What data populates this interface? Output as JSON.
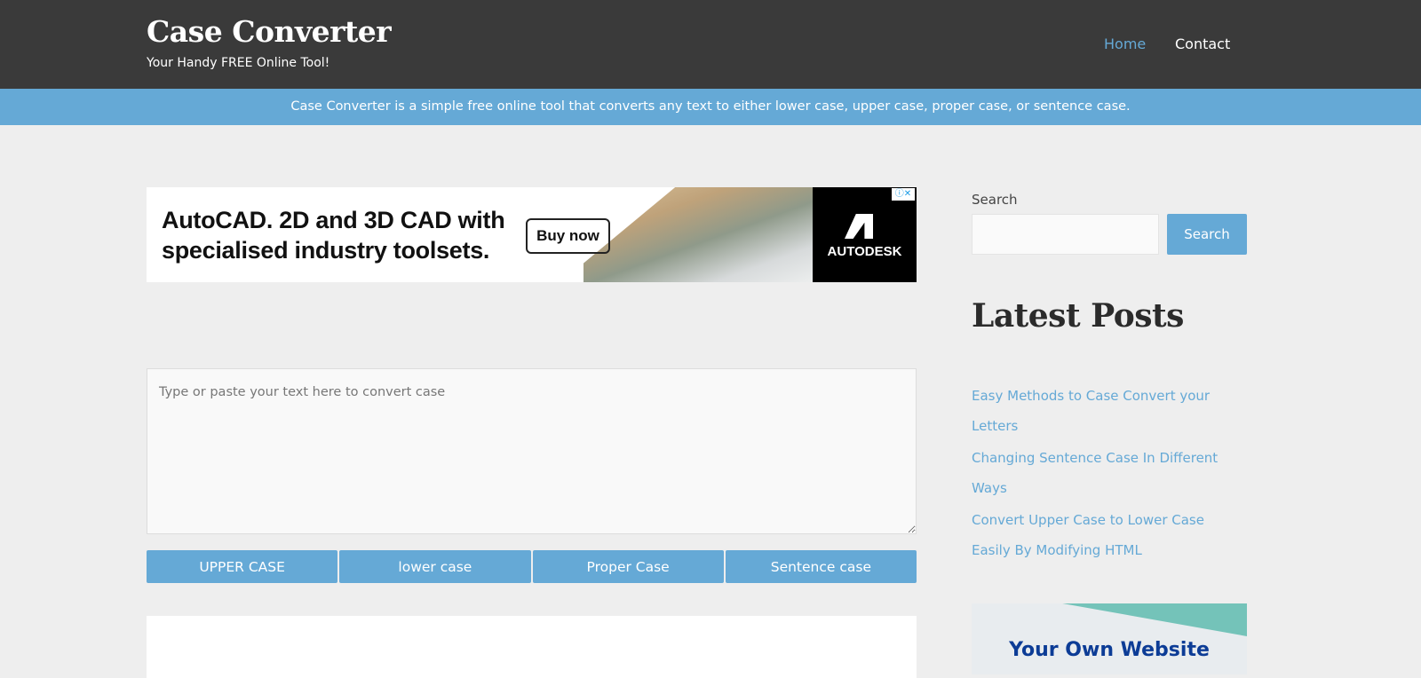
{
  "header": {
    "title": "Case Converter",
    "tagline": "Your Handy FREE Online Tool!",
    "nav": [
      {
        "label": "Home"
      },
      {
        "label": "Contact"
      }
    ]
  },
  "banner": {
    "text": "Case Converter is a simple free online tool that converts any text to either lower case, upper case, proper case, or sentence case."
  },
  "ad": {
    "headline_1": "AutoCAD. 2D and 3D CAD with",
    "headline_2": "specialised industry toolsets.",
    "cta": "Buy now",
    "brand": "AUTODESK",
    "info": "ⓘ✕"
  },
  "converter": {
    "placeholder": "Type or paste your text here to convert case",
    "value": "",
    "buttons": [
      {
        "label": "UPPER CASE"
      },
      {
        "label": "lower case"
      },
      {
        "label": "Proper Case"
      },
      {
        "label": "Sentence case"
      }
    ]
  },
  "sidebar": {
    "search_label": "Search",
    "search_button": "Search",
    "latest_title": "Latest Posts",
    "posts": [
      {
        "title": "Easy Methods to Case Convert your Letters"
      },
      {
        "title": "Changing Sentence Case In Different Ways"
      },
      {
        "title": "Convert Upper Case to Lower Case Easily By Modifying HTML"
      }
    ],
    "ad_text": "Your Own Website"
  }
}
